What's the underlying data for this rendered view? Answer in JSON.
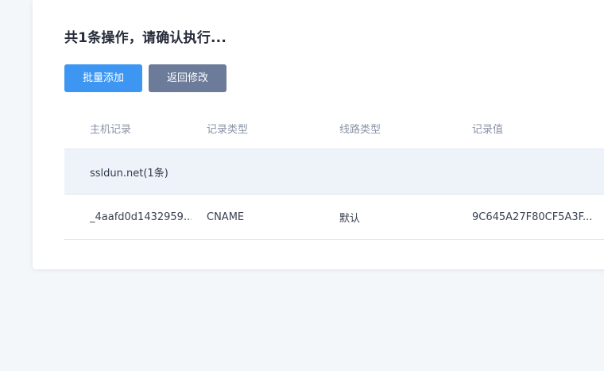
{
  "panel": {
    "title": "共1条操作，请确认执行..."
  },
  "actions": {
    "batch_add_label": "批量添加",
    "back_edit_label": "返回修改"
  },
  "table": {
    "columns": [
      "主机记录",
      "记录类型",
      "线路类型",
      "记录值"
    ],
    "group_label": "ssldun.net(1条)",
    "rows": [
      {
        "host": "_4aafd0d1432959...",
        "type": "CNAME",
        "line": "默认",
        "value": "9C645A27F80CF5A3F..."
      }
    ]
  },
  "colors": {
    "primary": "#3d97f2",
    "secondary": "#6b7b99",
    "background": "#f4f7fa",
    "group_row": "#eef3f9"
  }
}
